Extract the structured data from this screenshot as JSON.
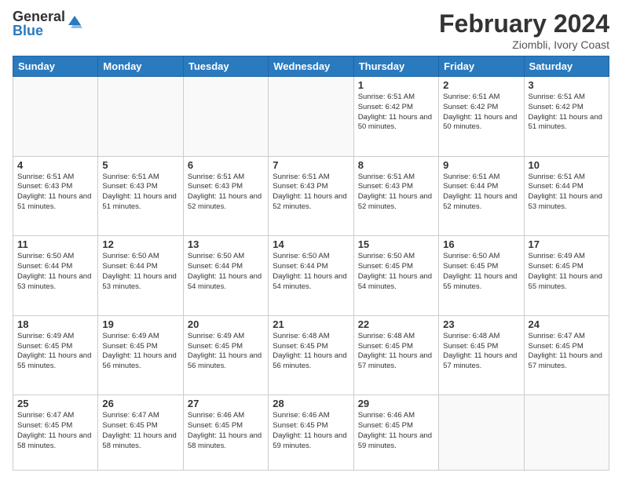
{
  "logo": {
    "general": "General",
    "blue": "Blue"
  },
  "header": {
    "month_title": "February 2024",
    "subtitle": "Ziombli, Ivory Coast"
  },
  "weekdays": [
    "Sunday",
    "Monday",
    "Tuesday",
    "Wednesday",
    "Thursday",
    "Friday",
    "Saturday"
  ],
  "weeks": [
    [
      {
        "day": "",
        "sunrise": "",
        "sunset": "",
        "daylight": ""
      },
      {
        "day": "",
        "sunrise": "",
        "sunset": "",
        "daylight": ""
      },
      {
        "day": "",
        "sunrise": "",
        "sunset": "",
        "daylight": ""
      },
      {
        "day": "",
        "sunrise": "",
        "sunset": "",
        "daylight": ""
      },
      {
        "day": "1",
        "sunrise": "6:51 AM",
        "sunset": "6:42 PM",
        "daylight": "11 hours and 50 minutes."
      },
      {
        "day": "2",
        "sunrise": "6:51 AM",
        "sunset": "6:42 PM",
        "daylight": "11 hours and 50 minutes."
      },
      {
        "day": "3",
        "sunrise": "6:51 AM",
        "sunset": "6:42 PM",
        "daylight": "11 hours and 51 minutes."
      }
    ],
    [
      {
        "day": "4",
        "sunrise": "6:51 AM",
        "sunset": "6:43 PM",
        "daylight": "11 hours and 51 minutes."
      },
      {
        "day": "5",
        "sunrise": "6:51 AM",
        "sunset": "6:43 PM",
        "daylight": "11 hours and 51 minutes."
      },
      {
        "day": "6",
        "sunrise": "6:51 AM",
        "sunset": "6:43 PM",
        "daylight": "11 hours and 52 minutes."
      },
      {
        "day": "7",
        "sunrise": "6:51 AM",
        "sunset": "6:43 PM",
        "daylight": "11 hours and 52 minutes."
      },
      {
        "day": "8",
        "sunrise": "6:51 AM",
        "sunset": "6:43 PM",
        "daylight": "11 hours and 52 minutes."
      },
      {
        "day": "9",
        "sunrise": "6:51 AM",
        "sunset": "6:44 PM",
        "daylight": "11 hours and 52 minutes."
      },
      {
        "day": "10",
        "sunrise": "6:51 AM",
        "sunset": "6:44 PM",
        "daylight": "11 hours and 53 minutes."
      }
    ],
    [
      {
        "day": "11",
        "sunrise": "6:50 AM",
        "sunset": "6:44 PM",
        "daylight": "11 hours and 53 minutes."
      },
      {
        "day": "12",
        "sunrise": "6:50 AM",
        "sunset": "6:44 PM",
        "daylight": "11 hours and 53 minutes."
      },
      {
        "day": "13",
        "sunrise": "6:50 AM",
        "sunset": "6:44 PM",
        "daylight": "11 hours and 54 minutes."
      },
      {
        "day": "14",
        "sunrise": "6:50 AM",
        "sunset": "6:44 PM",
        "daylight": "11 hours and 54 minutes."
      },
      {
        "day": "15",
        "sunrise": "6:50 AM",
        "sunset": "6:45 PM",
        "daylight": "11 hours and 54 minutes."
      },
      {
        "day": "16",
        "sunrise": "6:50 AM",
        "sunset": "6:45 PM",
        "daylight": "11 hours and 55 minutes."
      },
      {
        "day": "17",
        "sunrise": "6:49 AM",
        "sunset": "6:45 PM",
        "daylight": "11 hours and 55 minutes."
      }
    ],
    [
      {
        "day": "18",
        "sunrise": "6:49 AM",
        "sunset": "6:45 PM",
        "daylight": "11 hours and 55 minutes."
      },
      {
        "day": "19",
        "sunrise": "6:49 AM",
        "sunset": "6:45 PM",
        "daylight": "11 hours and 56 minutes."
      },
      {
        "day": "20",
        "sunrise": "6:49 AM",
        "sunset": "6:45 PM",
        "daylight": "11 hours and 56 minutes."
      },
      {
        "day": "21",
        "sunrise": "6:48 AM",
        "sunset": "6:45 PM",
        "daylight": "11 hours and 56 minutes."
      },
      {
        "day": "22",
        "sunrise": "6:48 AM",
        "sunset": "6:45 PM",
        "daylight": "11 hours and 57 minutes."
      },
      {
        "day": "23",
        "sunrise": "6:48 AM",
        "sunset": "6:45 PM",
        "daylight": "11 hours and 57 minutes."
      },
      {
        "day": "24",
        "sunrise": "6:47 AM",
        "sunset": "6:45 PM",
        "daylight": "11 hours and 57 minutes."
      }
    ],
    [
      {
        "day": "25",
        "sunrise": "6:47 AM",
        "sunset": "6:45 PM",
        "daylight": "11 hours and 58 minutes."
      },
      {
        "day": "26",
        "sunrise": "6:47 AM",
        "sunset": "6:45 PM",
        "daylight": "11 hours and 58 minutes."
      },
      {
        "day": "27",
        "sunrise": "6:46 AM",
        "sunset": "6:45 PM",
        "daylight": "11 hours and 58 minutes."
      },
      {
        "day": "28",
        "sunrise": "6:46 AM",
        "sunset": "6:45 PM",
        "daylight": "11 hours and 59 minutes."
      },
      {
        "day": "29",
        "sunrise": "6:46 AM",
        "sunset": "6:45 PM",
        "daylight": "11 hours and 59 minutes."
      },
      {
        "day": "",
        "sunrise": "",
        "sunset": "",
        "daylight": ""
      },
      {
        "day": "",
        "sunrise": "",
        "sunset": "",
        "daylight": ""
      }
    ]
  ]
}
